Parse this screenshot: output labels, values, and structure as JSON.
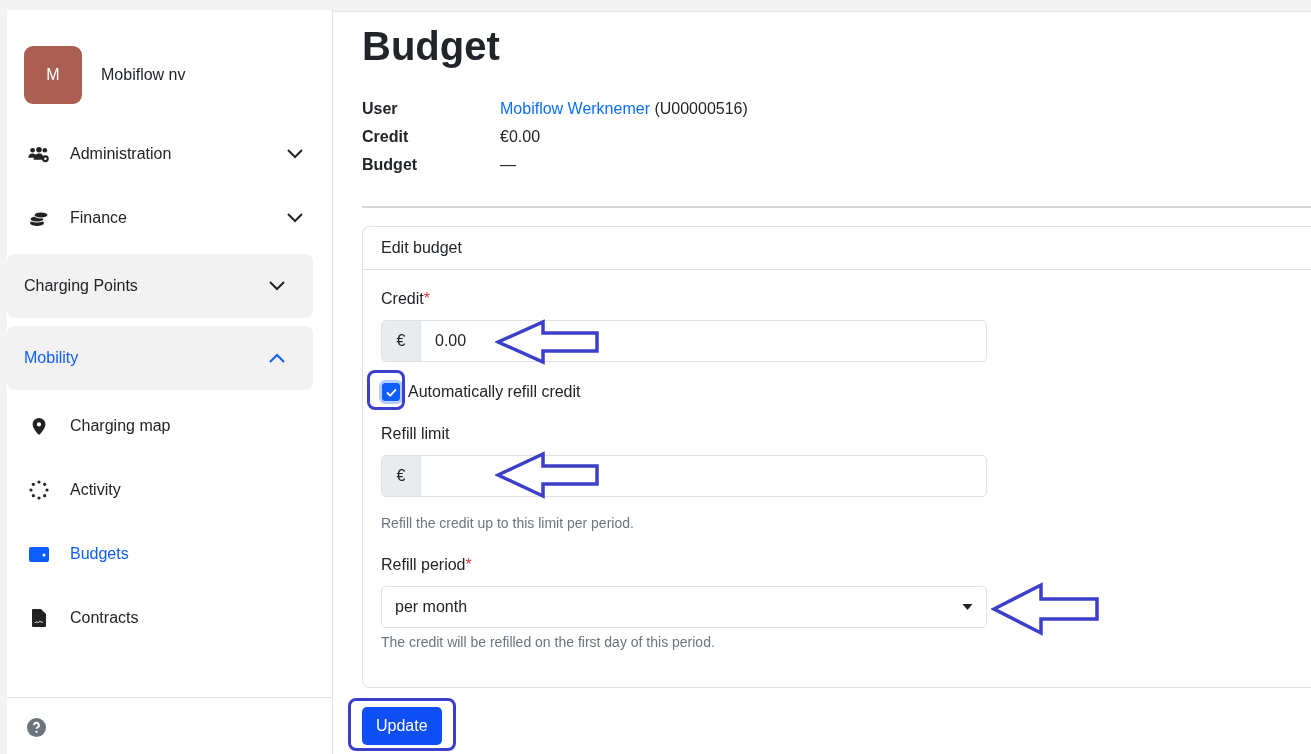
{
  "org": {
    "initial": "M",
    "name": "Mobiflow nv"
  },
  "nav": [
    {
      "kind": "menu",
      "label": "Administration",
      "expanded": false,
      "selected": false
    },
    {
      "kind": "menu",
      "label": "Finance",
      "expanded": false,
      "selected": false
    },
    {
      "kind": "group",
      "label": "Charging Points",
      "expanded": false,
      "selected": false
    },
    {
      "kind": "group",
      "label": "Mobility",
      "expanded": true,
      "selected": true,
      "children": [
        {
          "label": "Charging map",
          "selected": false
        },
        {
          "label": "Activity",
          "selected": false
        },
        {
          "label": "Budgets",
          "selected": true
        },
        {
          "label": "Contracts",
          "selected": false
        }
      ]
    }
  ],
  "page": {
    "title": "Budget",
    "details": [
      {
        "label": "User",
        "link": "Mobiflow Werknemer",
        "value": "(U00000516)"
      },
      {
        "label": "Credit",
        "value": "€0.00"
      },
      {
        "label": "Budget",
        "value": "—"
      }
    ]
  },
  "form": {
    "title": "Edit budget",
    "credit": {
      "label": "Credit",
      "required_mark": "*",
      "prefix": "€",
      "value": "0.00"
    },
    "auto_refill": {
      "label": "Automatically refill credit",
      "checked": true
    },
    "refill_limit": {
      "label": "Refill limit",
      "prefix": "€",
      "help": "Refill the credit up to this limit per period."
    },
    "refill_period": {
      "label": "Refill period",
      "required_mark": "*",
      "value": "per month",
      "help": "The credit will be refilled on the first day of this period."
    },
    "submit": "Update"
  }
}
